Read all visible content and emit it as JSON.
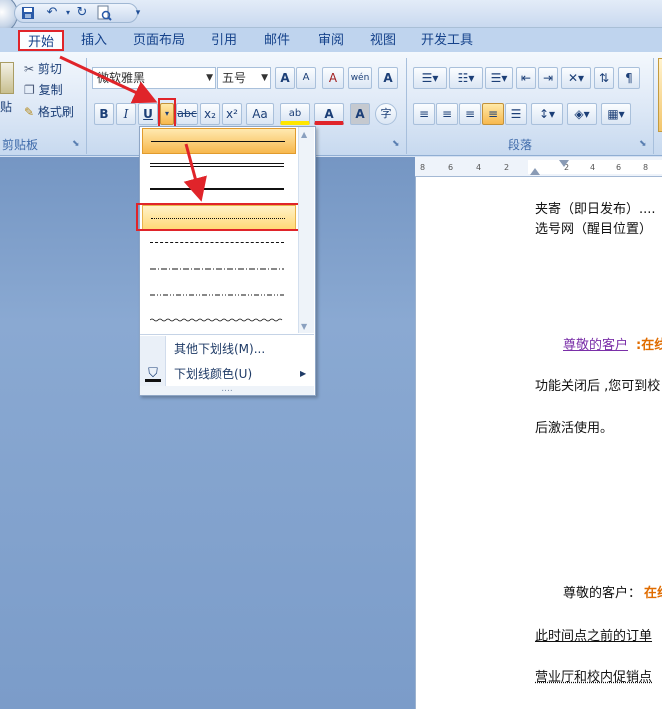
{
  "qat": {
    "save_icon": "save-icon",
    "undo_icon": "undo-icon",
    "redo_icon": "redo-icon",
    "preview_icon": "print-preview-icon"
  },
  "tabs": [
    {
      "id": "home",
      "label": "开始"
    },
    {
      "id": "insert",
      "label": "插入"
    },
    {
      "id": "layout",
      "label": "页面布局"
    },
    {
      "id": "ref",
      "label": "引用"
    },
    {
      "id": "mail",
      "label": "邮件"
    },
    {
      "id": "review",
      "label": "审阅"
    },
    {
      "id": "view",
      "label": "视图"
    },
    {
      "id": "dev",
      "label": "开发工具"
    }
  ],
  "clipboard": {
    "paste_label": "贴",
    "cut_label": "剪切",
    "copy_label": "复制",
    "format_painter_label": "格式刷",
    "group_label": "剪贴板"
  },
  "font": {
    "family_value": "微软雅黑",
    "size_value": "五号",
    "grow_label": "A",
    "shrink_label": "A",
    "clear_label": "A",
    "phonetic_label": "wén",
    "border_label": "A",
    "bold_label": "B",
    "italic_label": "I",
    "underline_label": "U",
    "strike_label": "abc",
    "subscript_label": "x₂",
    "superscript_label": "x²",
    "case_label": "Aa",
    "highlight_label": "ab",
    "color_label": "A",
    "shading_label": "A",
    "enclose_label": "字"
  },
  "paragraph": {
    "group_label": "段落"
  },
  "ruler": {
    "ticks": [
      "8",
      "6",
      "4",
      "2",
      "2",
      "4",
      "6",
      "8"
    ]
  },
  "dropdown": {
    "more_underlines": "其他下划线(M)...",
    "underline_color": "下划线颜色(U)",
    "more_dots": "....",
    "styles": [
      "single",
      "double",
      "thick",
      "dotted",
      "dashed",
      "dash-dot",
      "dash-dot-dot",
      "wavy"
    ]
  },
  "document": {
    "line1": "夹寄（即日发布）....",
    "line2": "选号网（醒目位置）",
    "line3_a": "尊敬的客户",
    "line3_b": ":在线",
    "line4": "功能关闭后 ,您可到校",
    "line5": "后激活使用。",
    "line6_a": "尊敬的客户：",
    "line6_b": "在线",
    "line7": "此时间点之前的订单",
    "line8": "营业厅和校内促销点"
  },
  "colors": {
    "accent_red": "#e0242a",
    "highlight_orange": "#f7b84e",
    "doc_orange": "#e06c00",
    "doc_purple": "#7a2fa8"
  }
}
